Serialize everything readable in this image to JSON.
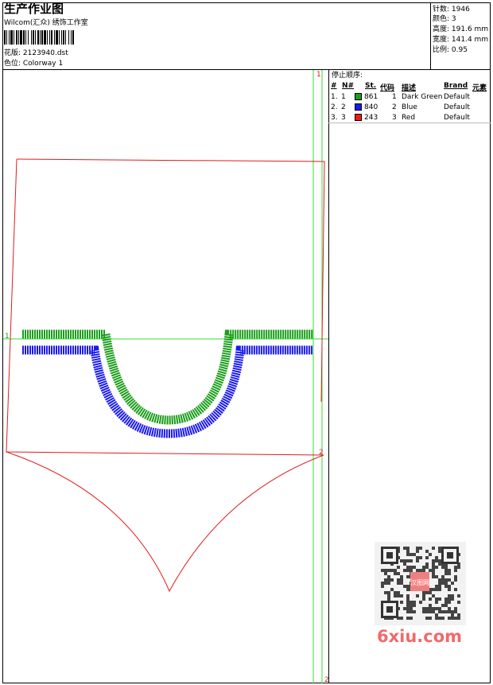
{
  "header": {
    "title": "生产作业图",
    "company": "Wilcom(汇众) 绣饰工作室",
    "file_line": "花版: 2123940.dst",
    "colorway_line": "色位: Colorway 1"
  },
  "stats": [
    {
      "label": "针数",
      "value": "1946"
    },
    {
      "label": "颜色",
      "value": "3"
    },
    {
      "label": "高度",
      "value": "191.6 mm"
    },
    {
      "label": "宽度",
      "value": "141.4 mm"
    },
    {
      "label": "比例",
      "value": "0.95"
    }
  ],
  "stop_sequence": {
    "title": "停止顺序:",
    "headers": {
      "index": "#",
      "needle": "N#",
      "st": "St.",
      "code": "代码",
      "desc": "描述",
      "brand": "Brand",
      "element": "元素"
    },
    "rows": [
      {
        "index": "1.",
        "needle": "1",
        "color": "#1a9e1a",
        "st": "861",
        "code": "1",
        "desc": "Dark Green",
        "brand": "Default"
      },
      {
        "index": "2.",
        "needle": "2",
        "color": "#1a1aee",
        "st": "840",
        "code": "2",
        "desc": "Blue",
        "brand": "Default"
      },
      {
        "index": "3.",
        "needle": "3",
        "color": "#ee1a1a",
        "st": "243",
        "code": "3",
        "desc": "Red",
        "brand": "Default"
      }
    ]
  },
  "design": {
    "guide_label_1": "1",
    "guide_label_2": "2",
    "colors": {
      "green": "#1a9e1a",
      "blue": "#1a1aee",
      "red": "#e01c1c",
      "guide": "#33dd33"
    }
  },
  "watermark": {
    "text": "6xiu.com",
    "stamp": "汉图网"
  }
}
